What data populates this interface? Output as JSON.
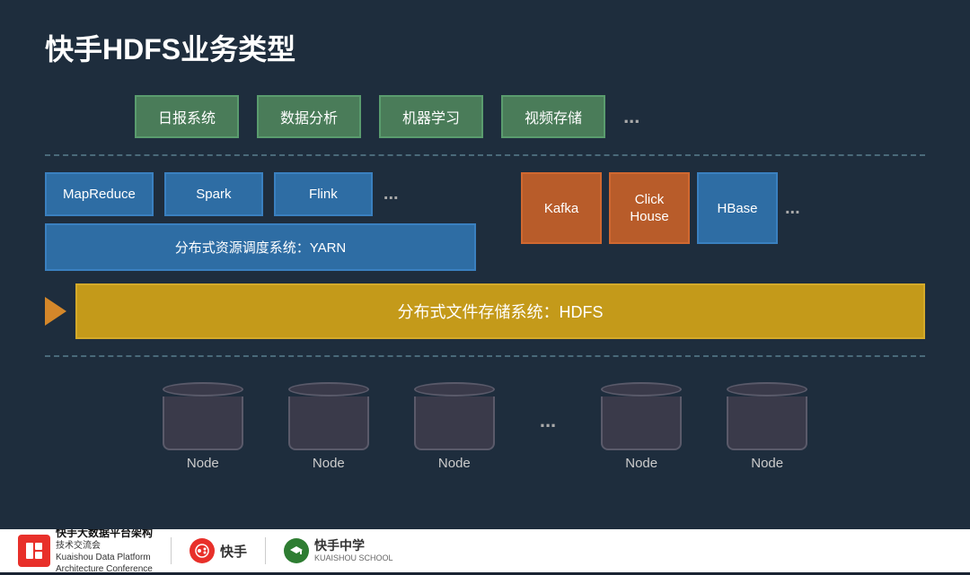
{
  "title": "快手HDFS业务类型",
  "top_row": {
    "items": [
      "日报系统",
      "数据分析",
      "机器学习",
      "视频存储"
    ],
    "dots": "..."
  },
  "middle": {
    "compute_boxes": [
      "MapReduce",
      "Spark",
      "Flink"
    ],
    "dots": "...",
    "yarn_label": "分布式资源调度系统：YARN",
    "right_boxes": [
      {
        "label": "Kafka",
        "color": "orange"
      },
      {
        "label": "Click\nHouse",
        "color": "orange"
      },
      {
        "label": "HBase",
        "color": "blue"
      }
    ],
    "right_dots": "..."
  },
  "hdfs": {
    "label": "分布式文件存储系统：HDFS"
  },
  "nodes": {
    "items": [
      "Node",
      "Node",
      "Node",
      "...",
      "Node",
      "Node"
    ]
  },
  "footer": {
    "logo_text_line1": "快手大数据平台架构",
    "logo_text_line2": "技术交流会",
    "logo_text_line3": "Kuaishou Data Platform",
    "logo_text_line4": "Architecture Conference",
    "brand1": "快手",
    "brand2": "快手中学",
    "brand2_sub": "KUAISHOU SCHOOL"
  }
}
